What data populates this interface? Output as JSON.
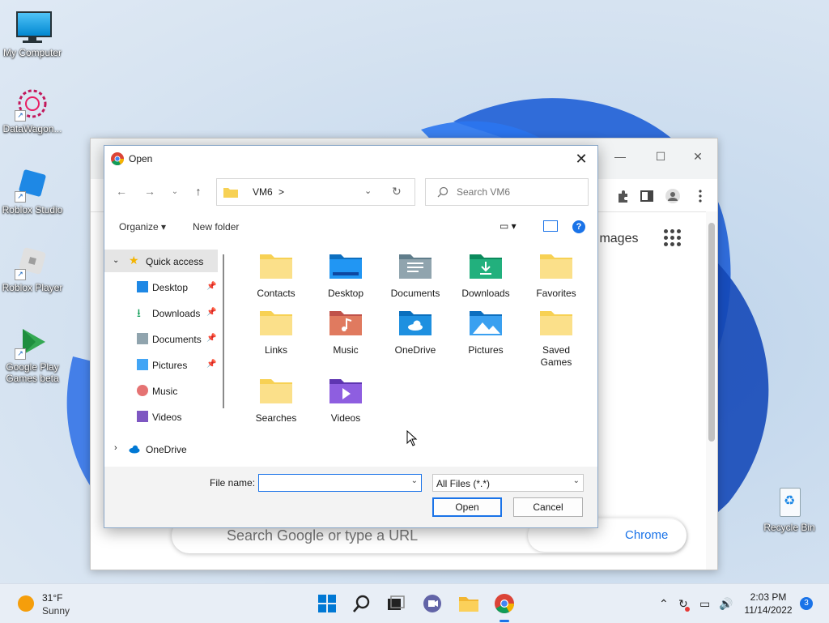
{
  "desktop": {
    "icons": [
      {
        "label": "My Computer"
      },
      {
        "label": "DataWagon..."
      },
      {
        "label": "Roblox Studio"
      },
      {
        "label": "Roblox Player"
      },
      {
        "label": "Google Play Games beta"
      },
      {
        "label": "Recycle Bin"
      }
    ]
  },
  "chrome": {
    "images_link": "Images",
    "search_placeholder": "Search Google or type a URL",
    "chrome_button": "Chrome"
  },
  "dialog": {
    "title": "Open",
    "address": {
      "crumb": "VM6",
      "separator": ">"
    },
    "search_placeholder": "Search VM6",
    "toolbar": {
      "organize": "Organize",
      "new_folder": "New folder"
    },
    "nav": {
      "quick_access": "Quick access",
      "items": [
        {
          "label": "Desktop",
          "pinned": true
        },
        {
          "label": "Downloads",
          "pinned": true
        },
        {
          "label": "Documents",
          "pinned": true
        },
        {
          "label": "Pictures",
          "pinned": true
        },
        {
          "label": "Music",
          "pinned": false
        },
        {
          "label": "Videos",
          "pinned": false
        }
      ],
      "onedrive": "OneDrive"
    },
    "files": [
      {
        "label": "Contacts",
        "icon": "folder-icon"
      },
      {
        "label": "Desktop",
        "icon": "desktop-folder-icon"
      },
      {
        "label": "Documents",
        "icon": "documents-folder-icon"
      },
      {
        "label": "Downloads",
        "icon": "downloads-folder-icon"
      },
      {
        "label": "Favorites",
        "icon": "folder-icon"
      },
      {
        "label": "Links",
        "icon": "folder-icon"
      },
      {
        "label": "Music",
        "icon": "music-folder-icon"
      },
      {
        "label": "OneDrive",
        "icon": "onedrive-folder-icon"
      },
      {
        "label": "Pictures",
        "icon": "pictures-folder-icon"
      },
      {
        "label": "Saved Games",
        "icon": "folder-icon"
      },
      {
        "label": "Searches",
        "icon": "folder-icon"
      },
      {
        "label": "Videos",
        "icon": "videos-folder-icon"
      }
    ],
    "file_name_label": "File name:",
    "file_name_value": "",
    "filter": "All Files (*.*)",
    "open_button": "Open",
    "cancel_button": "Cancel"
  },
  "taskbar": {
    "weather_temp": "31°F",
    "weather_cond": "Sunny",
    "time": "2:03 PM",
    "date": "11/14/2022",
    "notifications": "3"
  },
  "colors": {
    "accent": "#1a73e8",
    "folder": "#f7d154"
  }
}
